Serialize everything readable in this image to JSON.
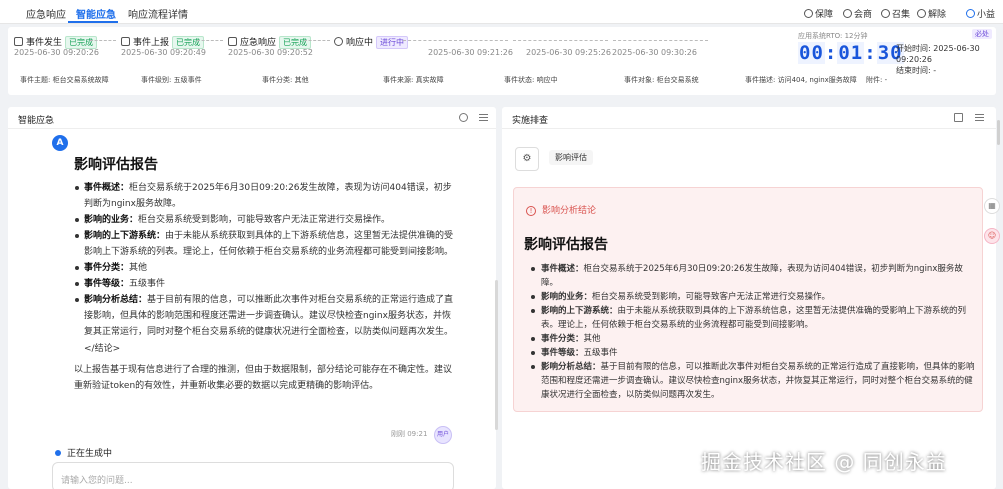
{
  "nav": {
    "tabs": [
      {
        "label": "应急响应"
      },
      {
        "label": "智能应急"
      },
      {
        "label": "响应流程详情"
      }
    ],
    "actions": [
      {
        "label": "保障"
      },
      {
        "label": "会商"
      },
      {
        "label": "召集"
      },
      {
        "label": "解除"
      },
      {
        "label": "小益"
      }
    ]
  },
  "steps": [
    {
      "name": "事件发生",
      "status": "已完成",
      "time": "2025-06-30 09:20:26"
    },
    {
      "name": "事件上报",
      "status": "已完成",
      "time": "2025-06-30 09:20:49"
    },
    {
      "name": "应急响应",
      "status": "已完成",
      "time": "2025-06-30 09:20:52"
    },
    {
      "name": "响应中",
      "status": "进行中",
      "time": ""
    },
    {
      "name": "",
      "status": "",
      "time": "2025-06-30 09:21:26"
    },
    {
      "name": "",
      "status": "",
      "time": "2025-06-30 09:25:26"
    },
    {
      "name": "",
      "status": "",
      "time": "2025-06-30 09:30:26"
    }
  ],
  "timer": {
    "label": "应用系统RTO: 12分钟",
    "d1": "00",
    "d2": "01",
    "d3": "30",
    "start_label": "开始时间: 2025-06-30 09:20:26",
    "end_label": "结束时间: -",
    "corner": "必处"
  },
  "meta": [
    "事件主题: 柜台交易系统故障",
    "事件级别: 五级事件",
    "事件分类: 其他",
    "事件来源: 真实故障",
    "事件状态: 响应中",
    "事件对象: 柜台交易系统",
    "事件描述: 访问404, nginx服务故障",
    "附件: -"
  ],
  "left_panel": {
    "title": "智能应急",
    "report_title": "影响评估报告",
    "items": [
      {
        "k": "事件概述",
        "v": "柜台交易系统于2025年6月30日09:20:26发生故障，表现为访问404错误，初步判断为nginx服务故障。"
      },
      {
        "k": "影响的业务",
        "v": "柜台交易系统受到影响，可能导致客户无法正常进行交易操作。"
      },
      {
        "k": "影响的上下游系统",
        "v": "由于未能从系统获取到具体的上下游系统信息，这里暂无法提供准确的受影响上下游系统的列表。理论上，任何依赖于柜台交易系统的业务流程都可能受到间接影响。"
      },
      {
        "k": "事件分类",
        "v": "其他"
      },
      {
        "k": "事件等级",
        "v": "五级事件"
      },
      {
        "k": "影响分析总结",
        "v": "基于目前有限的信息，可以推断此次事件对柜台交易系统的正常运行造成了直接影响，但具体的影响范围和程度还需进一步调查确认。建议尽快检查nginx服务状态，并恢复其正常运行，同时对整个柜台交易系统的健康状况进行全面检查，以防类似问题再次发生。"
      }
    ],
    "end_tag": "</结论>",
    "footnote": "以上报告基于现有信息进行了合理的推测，但由于数据限制，部分结论可能存在不确定性。建议重新验证token的有效性，并重新收集必要的数据以完成更精确的影响评估。",
    "reply_meta": "刚刚  09:21",
    "user_avatar": "用户",
    "generating": "正在生成中",
    "input_placeholder": "请输入您的问题..."
  },
  "right_panel": {
    "title": "实施排查",
    "tab_label": "影响评估",
    "conclusion_title": "影响分析结论",
    "report_title": "影响评估报告",
    "items": [
      {
        "k": "事件概述",
        "v": "柜台交易系统于2025年6月30日09:20:26发生故障，表现为访问404错误，初步判断为nginx服务故障。"
      },
      {
        "k": "影响的业务",
        "v": "柜台交易系统受到影响，可能导致客户无法正常进行交易操作。"
      },
      {
        "k": "影响的上下游系统",
        "v": "由于未能从系统获取到具体的上下游系统信息，这里暂无法提供准确的受影响上下游系统的列表。理论上，任何依赖于柜台交易系统的业务流程都可能受到间接影响。"
      },
      {
        "k": "事件分类",
        "v": "其他"
      },
      {
        "k": "事件等级",
        "v": "五级事件"
      },
      {
        "k": "影响分析总结",
        "v": "基于目前有限的信息，可以推断此次事件对柜台交易系统的正常运行造成了直接影响，但具体的影响范围和程度还需进一步调查确认。建议尽快检查nginx服务状态，并恢复其正常运行，同时对整个柜台交易系统的健康状况进行全面检查，以防类似问题再次发生。"
      }
    ]
  },
  "watermark": "掘金技术社区 @ 同创永益",
  "colors": {
    "accent": "#1f6feb",
    "done": "#1aa35a",
    "going": "#6b4ad8",
    "danger": "#d9534f"
  }
}
